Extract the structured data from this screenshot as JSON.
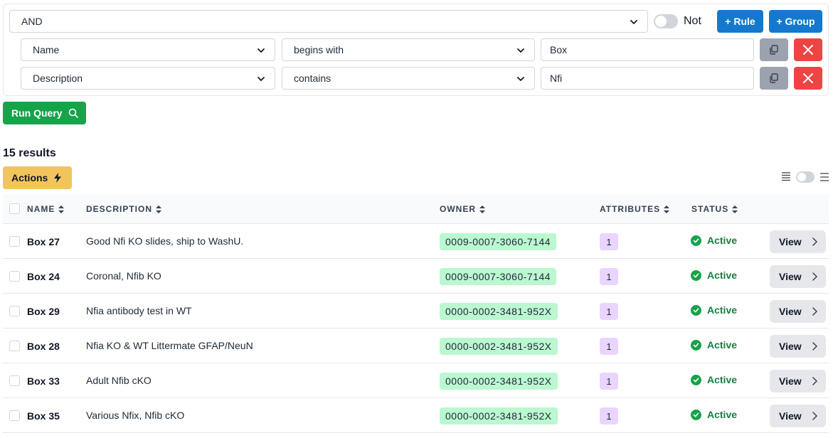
{
  "query_builder": {
    "combinator": "AND",
    "not_label": "Not",
    "add_rule_label": "+ Rule",
    "add_group_label": "+ Group",
    "rules": [
      {
        "field": "Name",
        "operator": "begins with",
        "value": "Box"
      },
      {
        "field": "Description",
        "operator": "contains",
        "value": "Nfi"
      }
    ]
  },
  "run_query_label": "Run Query",
  "results_count": "15 results",
  "actions_label": "Actions",
  "table": {
    "headers": {
      "name": "NAME",
      "description": "DESCRIPTION",
      "owner": "OWNER",
      "attributes": "ATTRIBUTES",
      "status": "STATUS"
    },
    "view_label": "View",
    "rows": [
      {
        "name": "Box 27",
        "description": "Good Nfi KO slides, ship to WashU.",
        "owner": "0009-0007-3060-7144",
        "attributes": "1",
        "status": "Active"
      },
      {
        "name": "Box 24",
        "description": "Coronal, Nfib KO",
        "owner": "0009-0007-3060-7144",
        "attributes": "1",
        "status": "Active"
      },
      {
        "name": "Box 29",
        "description": "Nfia antibody test in WT",
        "owner": "0000-0002-3481-952X",
        "attributes": "1",
        "status": "Active"
      },
      {
        "name": "Box 28",
        "description": "Nfia KO & WT Littermate GFAP/NeuN",
        "owner": "0000-0002-3481-952X",
        "attributes": "1",
        "status": "Active"
      },
      {
        "name": "Box 33",
        "description": "Adult Nfib cKO",
        "owner": "0000-0002-3481-952X",
        "attributes": "1",
        "status": "Active"
      },
      {
        "name": "Box 35",
        "description": "Various Nfix, Nfib cKO",
        "owner": "0000-0002-3481-952X",
        "attributes": "1",
        "status": "Active"
      }
    ]
  },
  "colors": {
    "primary": "#1479cc",
    "success": "#16a34a",
    "danger": "#ef4444",
    "warning": "#f2c55c",
    "owner_badge": "#bbf7d0",
    "attr_badge": "#e9d5ff"
  }
}
